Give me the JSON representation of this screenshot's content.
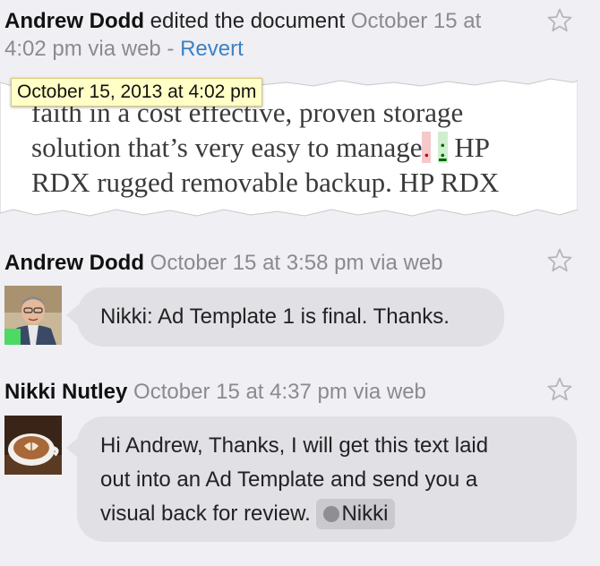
{
  "entries": [
    {
      "author": "Andrew Dodd",
      "action": " edited the document ",
      "meta_line1": "October 15 at",
      "meta_line2": "4:02 pm via web - ",
      "revert_label": "Revert",
      "tooltip": "October 15, 2013 at 4:02 pm",
      "doc_lines": {
        "line1": "faith in a cost effective, proven storage",
        "line2_a": "solution that’s very easy to manage",
        "line2_del": ".",
        "line2_ins": ":",
        "line2_b": " HP",
        "line3": "RDX rugged removable backup. HP RDX"
      }
    },
    {
      "author": "Andrew Dodd",
      "meta": " October 15 at 3:58 pm via web",
      "message": "Nikki: Ad Template 1 is final. Thanks."
    },
    {
      "author": "Nikki Nutley",
      "meta": " October 15 at 4:37 pm via web",
      "message_line1": "Hi Andrew, Thanks, I will get this text laid",
      "message_line2": "out into an Ad Template and send you a",
      "message_line3": "visual back for review. ",
      "mention": "Nikki"
    }
  ],
  "icons": {
    "star": "star-outline-icon",
    "avatar_andrew": "avatar-andrew",
    "avatar_nikki": "avatar-nikki-coffee"
  },
  "colors": {
    "background": "#efeff4",
    "bubble": "#e0e0e5",
    "link": "#3b82c4",
    "presence": "#4cd964"
  }
}
